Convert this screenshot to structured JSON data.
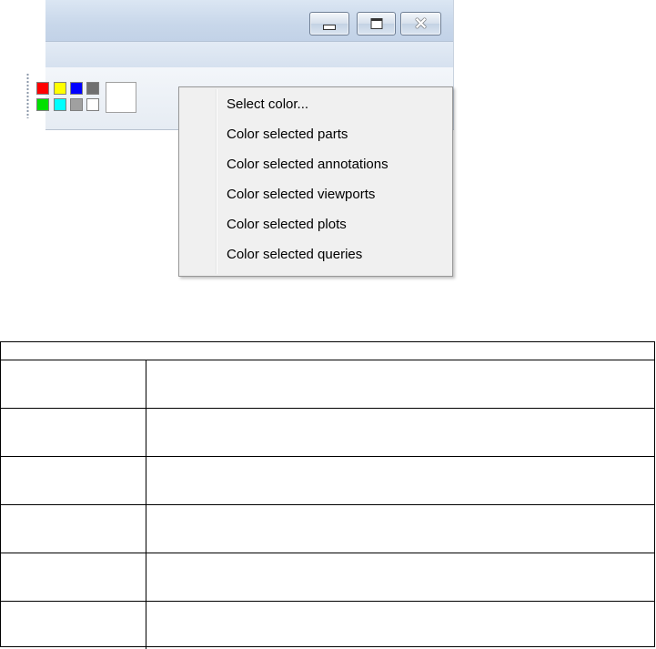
{
  "window": {
    "buttons": {
      "minimize": "minimize",
      "maximize": "maximize",
      "close": "close"
    }
  },
  "color_toolbar": {
    "swatches": [
      "#ff0000",
      "#ffff00",
      "#0000ff",
      "#707070",
      "#00e000",
      "#00ffff",
      "#a0a0a0",
      "#ffffff"
    ],
    "current_color": "#ffffff"
  },
  "context_menu": {
    "items": [
      "Select color...",
      "Color selected parts",
      "Color selected annotations",
      "Color selected viewports",
      "Color selected plots",
      "Color selected queries"
    ]
  },
  "table": {
    "header": "",
    "rows": [
      {
        "c1": "",
        "c2": ""
      },
      {
        "c1": "",
        "c2": ""
      },
      {
        "c1": "",
        "c2": ""
      },
      {
        "c1": "",
        "c2": ""
      },
      {
        "c1": "",
        "c2": ""
      },
      {
        "c1": "",
        "c2": ""
      }
    ]
  }
}
